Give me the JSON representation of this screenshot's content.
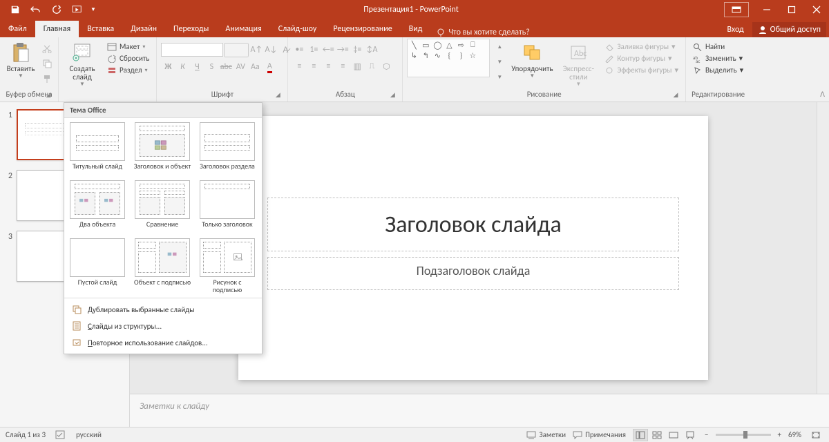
{
  "title": "Презентация1 - PowerPoint",
  "tabs": {
    "file": "Файл",
    "home": "Главная",
    "insert": "Вставка",
    "design": "Дизайн",
    "transitions": "Переходы",
    "animations": "Анимация",
    "slideshow": "Слайд-шоу",
    "review": "Рецензирование",
    "view": "Вид",
    "tellme": "Что вы хотите сделать?"
  },
  "auth": {
    "login": "Вход",
    "share": "Общий доступ"
  },
  "ribbon": {
    "clipboard": {
      "paste": "Вставить",
      "label": "Буфер обмена"
    },
    "slides": {
      "new_slide": "Создать слайд",
      "layout": "Макет",
      "reset": "Сбросить",
      "section": "Раздел"
    },
    "font": {
      "label": "Шрифт"
    },
    "paragraph": {
      "label": "Абзац"
    },
    "drawing": {
      "label": "Рисование",
      "arrange": "Упорядочить",
      "quick_styles": "Экспресс-стили",
      "shape_fill": "Заливка фигуры",
      "shape_outline": "Контур фигуры",
      "shape_effects": "Эффекты фигуры"
    },
    "editing": {
      "label": "Редактирование",
      "find": "Найти",
      "replace": "Заменить",
      "select": "Выделить"
    }
  },
  "layouts_popup": {
    "theme_header": "Тема Office",
    "layouts": [
      "Титульный слайд",
      "Заголовок и объект",
      "Заголовок раздела",
      "Два объекта",
      "Сравнение",
      "Только заголовок",
      "Пустой слайд",
      "Объект с подписью",
      "Рисунок с подписью"
    ],
    "menu": {
      "duplicate": "Дублировать выбранные слайды",
      "from_outline": "Слайды из структуры...",
      "reuse": "Повторное использование слайдов..."
    }
  },
  "slide": {
    "title_placeholder": "Заголовок слайда",
    "subtitle_placeholder": "Подзаголовок слайда"
  },
  "thumbs": [
    "1",
    "2",
    "3"
  ],
  "notes_placeholder": "Заметки к слайду",
  "status": {
    "slide_of": "Слайд 1 из 3",
    "language": "русский",
    "notes_btn": "Заметки",
    "comments_btn": "Примечания",
    "zoom": "69%"
  }
}
